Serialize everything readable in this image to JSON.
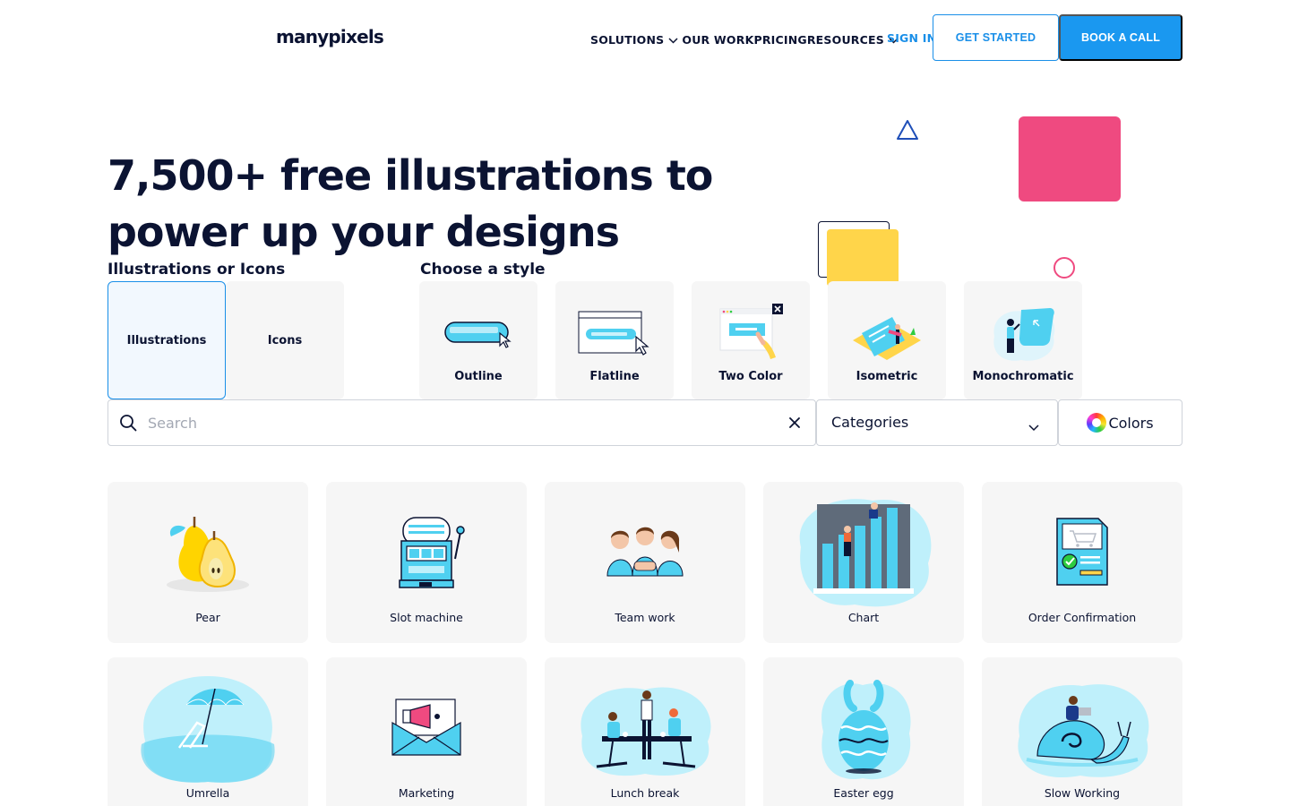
{
  "brand": {
    "logo": "manypixels"
  },
  "nav": {
    "items": [
      {
        "label": "SOLUTIONS",
        "dropdown": true
      },
      {
        "label": "OUR WORK",
        "dropdown": false
      },
      {
        "label": "PRICING",
        "dropdown": false
      },
      {
        "label": "RESOURCES",
        "dropdown": true
      }
    ],
    "sign_in": "SIGN IN",
    "get_started": "GET STARTED",
    "book_call": "BOOK A CALL"
  },
  "hero": {
    "title_line1": "7,500+ free illustrations to",
    "title_line2": "power up your designs"
  },
  "filters": {
    "type_label": "Illustrations or Icons",
    "types": [
      {
        "label": "Illustrations",
        "selected": true
      },
      {
        "label": "Icons",
        "selected": false
      }
    ],
    "style_label": "Choose a style",
    "styles": [
      {
        "label": "Outline",
        "icon": "outline-style-thumbnail"
      },
      {
        "label": "Flatline",
        "icon": "flatline-style-thumbnail"
      },
      {
        "label": "Two Color",
        "icon": "two-color-style-thumbnail"
      },
      {
        "label": "Isometric",
        "icon": "isometric-style-thumbnail"
      },
      {
        "label": "Monochromatic",
        "icon": "monochromatic-style-thumbnail"
      }
    ],
    "search": {
      "placeholder": "Search",
      "value": ""
    },
    "categories": "Categories",
    "colors": "Colors"
  },
  "illustrations": [
    {
      "name": "Pear",
      "icon": "pear-illustration"
    },
    {
      "name": "Slot machine",
      "icon": "slot-machine-illustration"
    },
    {
      "name": "Team work",
      "icon": "team-work-illustration"
    },
    {
      "name": "Chart",
      "icon": "chart-illustration"
    },
    {
      "name": "Order Confirmation",
      "icon": "order-confirmation-illustration"
    },
    {
      "name": "Umrella",
      "icon": "umbrella-illustration"
    },
    {
      "name": "Marketing",
      "icon": "marketing-illustration"
    },
    {
      "name": "Lunch break",
      "icon": "lunch-break-illustration"
    },
    {
      "name": "Easter egg",
      "icon": "easter-egg-illustration"
    },
    {
      "name": "Slow Working",
      "icon": "slow-working-illustration"
    }
  ],
  "colors_theme": {
    "accent": "#1a98f0",
    "text": "#0b1332",
    "illustration_blue": "#4fd0f0",
    "deco_pink": "#ef4a80",
    "deco_yellow": "#ffd54a"
  }
}
